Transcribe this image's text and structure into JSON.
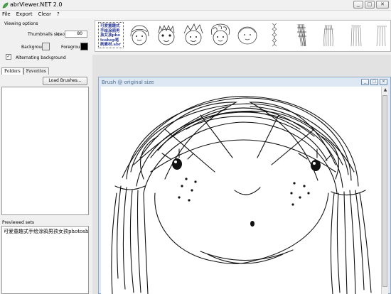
{
  "window": {
    "title": "abrViewer.NET 2.0",
    "buttons": [
      "_",
      "□",
      "✕"
    ]
  },
  "menu": [
    "File",
    "Export",
    "Clear",
    "?"
  ],
  "viewing_options": {
    "heading": "Viewing options",
    "thumbnail_size_label": "Thumbnails size:",
    "thumbnail_size_arrow": "<-->",
    "thumbnail_size_value": "80",
    "background_label": "Background:",
    "foreground_label": "Foreground:",
    "alternating_label": "Alternating background",
    "alternating_checked": "✓",
    "background_color": "#e6e6e6",
    "foreground_color": "#000000"
  },
  "tabs": [
    "Folders",
    "Favorites"
  ],
  "load_button": "Load Brushes...",
  "previewed_label": "Previewed sets",
  "previewed_items": [
    "可爱童趣式手绘涂鸦男孩女孩photoshop笔刷素"
  ],
  "thumb_text": "可爱童趣式手绘涂鸦男孩女孩photoshop笔刷素材.abr",
  "brush_window": {
    "title": "Brush @ original size",
    "buttons": [
      "_",
      "□",
      "✕"
    ]
  },
  "scroll_arrows": {
    "up": "▲",
    "down": "▼"
  }
}
